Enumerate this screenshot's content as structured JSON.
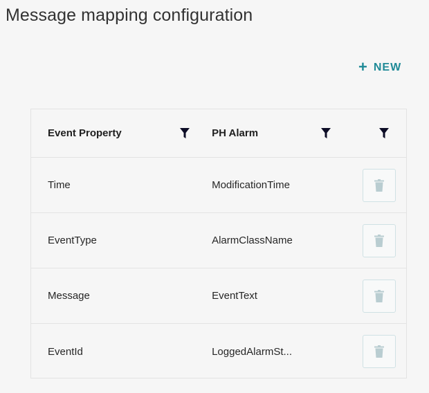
{
  "page": {
    "title": "Message mapping configuration"
  },
  "toolbar": {
    "new_icon": "+",
    "new_label": "NEW"
  },
  "grid": {
    "columns": [
      {
        "label": "Event Property",
        "filter_icon": "filter-icon"
      },
      {
        "label": "PH Alarm",
        "filter_icon": "filter-icon"
      },
      {
        "label": "",
        "filter_icon": "filter-icon"
      }
    ],
    "rows": [
      {
        "event_property": "Time",
        "ph_alarm": "ModificationTime",
        "action_icon": "trash-icon"
      },
      {
        "event_property": "EventType",
        "ph_alarm": "AlarmClassName",
        "action_icon": "trash-icon"
      },
      {
        "event_property": "Message",
        "ph_alarm": "EventText",
        "action_icon": "trash-icon"
      },
      {
        "event_property": "EventId",
        "ph_alarm": "LoggedAlarmSt...",
        "action_icon": "trash-icon"
      }
    ]
  },
  "colors": {
    "accent": "#1f8a97",
    "trash_disabled": "#b9cdd1",
    "filter": "#0d0d26"
  }
}
